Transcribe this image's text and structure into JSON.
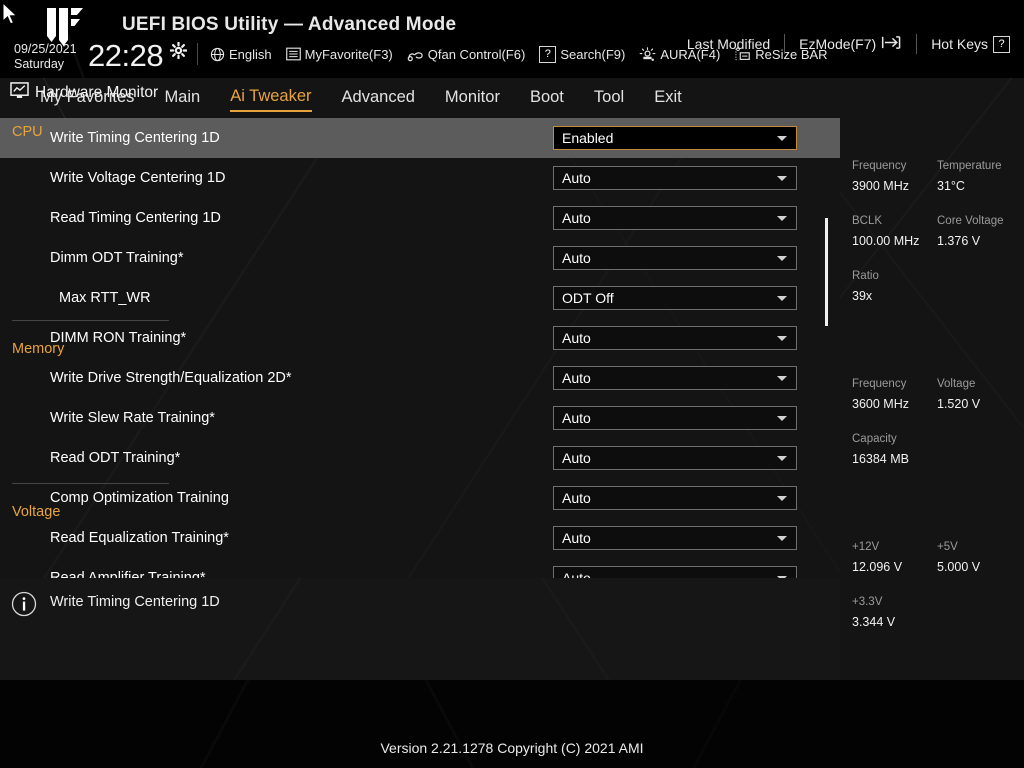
{
  "header": {
    "logo_icon": "tuf-shield-logo",
    "cursor_icon": "mouse-pointer-icon",
    "title": "UEFI BIOS Utility — Advanced Mode",
    "date": "09/25/2021",
    "weekday": "Saturday",
    "time": "22:28",
    "gear_icon": "gear-icon",
    "tools": [
      {
        "label": "English",
        "icon": "globe-icon"
      },
      {
        "label": "MyFavorite(F3)",
        "icon": "list-icon"
      },
      {
        "label": "Qfan Control(F6)",
        "icon": "fan-icon"
      },
      {
        "label": "Search(F9)",
        "icon": "question-box-icon"
      },
      {
        "label": "AURA(F4)",
        "icon": "aura-light-icon"
      },
      {
        "label": "ReSize BAR",
        "icon": "resize-bar-icon"
      }
    ]
  },
  "nav": {
    "tabs": [
      {
        "label": "My Favorites",
        "active": false
      },
      {
        "label": "Main",
        "active": false
      },
      {
        "label": "Ai Tweaker",
        "active": true
      },
      {
        "label": "Advanced",
        "active": false
      },
      {
        "label": "Monitor",
        "active": false
      },
      {
        "label": "Boot",
        "active": false
      },
      {
        "label": "Tool",
        "active": false
      },
      {
        "label": "Exit",
        "active": false
      }
    ],
    "active_color": "#e8a33d"
  },
  "settings": {
    "rows": [
      {
        "label": "Write Timing Centering 1D",
        "value": "Enabled",
        "selected": true,
        "indent": false
      },
      {
        "label": "Write Voltage Centering 1D",
        "value": "Auto",
        "selected": false,
        "indent": false
      },
      {
        "label": "Read Timing Centering 1D",
        "value": "Auto",
        "selected": false,
        "indent": false
      },
      {
        "label": "Dimm ODT Training*",
        "value": "Auto",
        "selected": false,
        "indent": false
      },
      {
        "label": "Max RTT_WR",
        "value": "ODT Off",
        "selected": false,
        "indent": true
      },
      {
        "label": "DIMM RON Training*",
        "value": "Auto",
        "selected": false,
        "indent": false
      },
      {
        "label": "Write Drive Strength/Equalization 2D*",
        "value": "Auto",
        "selected": false,
        "indent": false
      },
      {
        "label": "Write Slew Rate Training*",
        "value": "Auto",
        "selected": false,
        "indent": false
      },
      {
        "label": "Read ODT Training*",
        "value": "Auto",
        "selected": false,
        "indent": false
      },
      {
        "label": "Comp Optimization Training",
        "value": "Auto",
        "selected": false,
        "indent": false
      },
      {
        "label": "Read Equalization Training*",
        "value": "Auto",
        "selected": false,
        "indent": false
      },
      {
        "label": "Read Amplifier Training*",
        "value": "Auto",
        "selected": false,
        "indent": false
      }
    ],
    "selected_highlight_color": "#5c5c5c",
    "selected_border_color": "#c28a3c"
  },
  "help": {
    "icon": "info-circle-icon",
    "text": "Write Timing Centering 1D"
  },
  "hardware_monitor": {
    "icon": "monitor-chart-icon",
    "title": "Hardware Monitor",
    "sections": [
      {
        "name": "CPU",
        "entries": [
          {
            "key": "Frequency",
            "value": "3900 MHz"
          },
          {
            "key": "Temperature",
            "value": "31°C"
          },
          {
            "key": "BCLK",
            "value": "100.00 MHz"
          },
          {
            "key": "Core Voltage",
            "value": "1.376 V"
          },
          {
            "key": "Ratio",
            "value": "39x"
          }
        ]
      },
      {
        "name": "Memory",
        "entries": [
          {
            "key": "Frequency",
            "value": "3600 MHz"
          },
          {
            "key": "Voltage",
            "value": "1.520 V"
          },
          {
            "key": "Capacity",
            "value": "16384 MB"
          }
        ]
      },
      {
        "name": "Voltage",
        "entries": [
          {
            "key": "+12V",
            "value": "12.096 V"
          },
          {
            "key": "+5V",
            "value": "5.000 V"
          },
          {
            "key": "+3.3V",
            "value": "3.344 V"
          }
        ]
      }
    ],
    "section_color": "#e8a33d"
  },
  "footer": {
    "links": [
      {
        "label": "Last Modified",
        "icon": ""
      },
      {
        "label": "EzMode(F7)",
        "icon": "arrow-right-exit-icon"
      },
      {
        "label": "Hot Keys",
        "icon": "question-box-icon"
      }
    ],
    "version": "Version 2.21.1278 Copyright (C) 2021 AMI"
  }
}
